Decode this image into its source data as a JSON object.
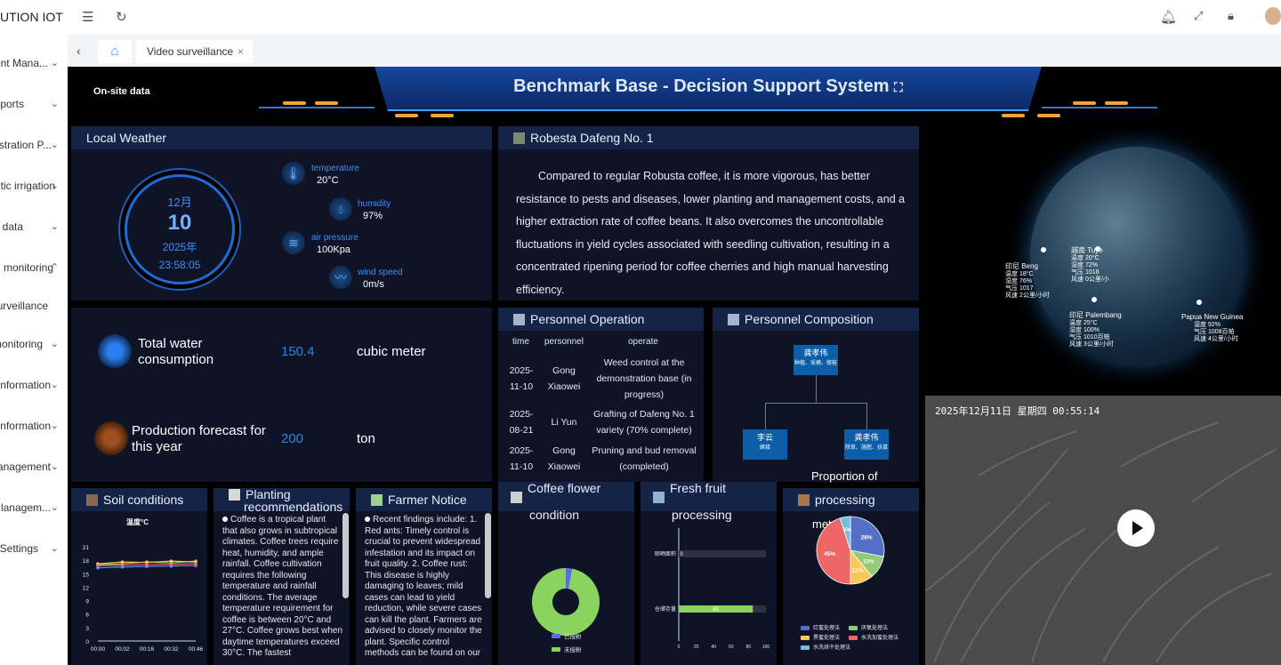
{
  "sidebar": {
    "brand": "UTION IOT",
    "items": [
      {
        "label": "ent Mana...",
        "chevron": "⌄"
      },
      {
        "label": "ports",
        "chevron": "⌄"
      },
      {
        "label": "stration P...",
        "chevron": "⌄"
      },
      {
        "label": "tic irrigation",
        "chevron": "⌄"
      },
      {
        "label": "data",
        "chevron": "⌄"
      },
      {
        "label": "monitoring",
        "chevron": "⌃"
      },
      {
        "label": "urveillance",
        "chevron": ""
      },
      {
        "label": "nonitoring",
        "chevron": "⌄"
      },
      {
        "label": "nformation",
        "chevron": "⌄"
      },
      {
        "label": "nformation",
        "chevron": "⌄"
      },
      {
        "label": "anagement",
        "chevron": "⌄"
      },
      {
        "label": "lanagem...",
        "chevron": "⌄"
      },
      {
        "label": "Settings",
        "chevron": "⌄"
      }
    ]
  },
  "tabs": {
    "active_label": "Video surveillance",
    "close": "×"
  },
  "dashboard": {
    "onsite_label": "On-site data",
    "title": "Benchmark Base - Decision Support System",
    "title_icon": "⛶",
    "weather": {
      "title": "Local Weather",
      "month": "12月",
      "day": "10",
      "year": "2025年",
      "time": "23:58:05",
      "temperature_label": "temperature",
      "temperature": "20°C",
      "humidity_label": "humidity",
      "humidity": "97%",
      "pressure_label": "air pressure",
      "pressure": "100Kpa",
      "wind_label": "wind speed",
      "wind": "0m/s"
    },
    "water": {
      "label_1": "Total water",
      "label_2": "consumption",
      "value": "150.4",
      "unit": "cubic meter"
    },
    "forecast": {
      "label_1": "Production forecast for",
      "label_2": "this year",
      "value": "200",
      "unit": "ton"
    },
    "variety": {
      "title": "Robesta Dafeng No. 1",
      "description": "Compared to regular Robusta coffee, it is more vigorous, has better resistance to pests and diseases, lower planting and management costs, and a higher extraction rate of coffee beans. It also overcomes the uncontrollable fluctuations in yield cycles associated with seedling cultivation, resulting in a concentrated ripening period for coffee cherries and high manual harvesting efficiency."
    },
    "personnel_op": {
      "title": "Personnel Operation",
      "headers": [
        "time",
        "personnel",
        "operate"
      ],
      "rows": [
        {
          "date_1": "2025-",
          "date_2": "11-10",
          "person_1": "Gong",
          "person_2": "Xiaowei",
          "op_1": "Weed control at the",
          "op_2": "demonstration base (in",
          "op_3": "progress)"
        },
        {
          "date_1": "2025-",
          "date_2": "08-21",
          "person_1": "Li Yun",
          "person_2": "",
          "op_1": "Grafting of Dafeng No. 1",
          "op_2": "variety (70% complete)",
          "op_3": ""
        },
        {
          "date_1": "2025-",
          "date_2": "11-10",
          "person_1": "Gong",
          "person_2": "Xiaowei",
          "op_1": "Pruning and bud removal",
          "op_2": "(completed)",
          "op_3": ""
        }
      ]
    },
    "personnel_comp": {
      "title": "Personnel Composition",
      "top": {
        "name": "龚孝伟",
        "role": "种植、采摘、修枝"
      },
      "left": {
        "name": "李云",
        "role": "嫁接"
      },
      "right": {
        "name": "龚孝伟",
        "role": "除草、施肥、扶苗"
      }
    },
    "proportion_label": "Proportion of",
    "soil": {
      "title": "Soil conditions",
      "chart_title": "温度°C"
    },
    "planting": {
      "title_1": "Planting",
      "title_2": "recommendations",
      "text": "Coffee is a tropical plant that also grows in subtropical climates. Coffee trees require heat, humidity, and ample rainfall. Coffee cultivation requires the following temperature and rainfall conditions. The average temperature requirement for coffee is between 20°C and 27°C. Coffee grows best when daytime temperatures exceed 30°C. The fastest"
    },
    "farmer": {
      "title": "Farmer Notice",
      "text": "Recent findings include: 1. Red ants: Timely control is crucial to prevent widespread infestation and its impact on fruit quality. 2. Coffee rust: This disease is highly damaging to leaves; mild cases can lead to yield reduction, while severe cases can kill the plant. Farmers are advised to closely monitor the plant. Specific control methods can be found on our"
    },
    "flower": {
      "title_1": "Coffee flower",
      "title_2": "condition"
    },
    "fruit": {
      "title_1": "Fresh fruit",
      "title_2": "processing"
    },
    "method": {
      "title": "processing",
      "title_2": "met"
    },
    "globe_labels": [
      {
        "name": "印尼 Beng",
        "lines": "温度 18°C\n湿度 76%\n气压 1017\n风速 2公里/小时"
      },
      {
        "name": "越南 Tuye",
        "lines": "温度 20°C\n湿度 72%\n气压 1018\n风速 0公里/小"
      },
      {
        "name": "印尼 Palembang",
        "lines": "温度 25°C\n湿度 100%\n气压 1010百帕\n风速 3公里/小时"
      },
      {
        "name": "Papua New Guinea",
        "lines": "湿度 92%\n气压 1008百帕\n风速 4公里/小时"
      }
    ],
    "camera": {
      "timestamp": "2025年12月11日 星期四 00:55:14"
    }
  },
  "chart_data": [
    {
      "type": "line",
      "title": "温度°C",
      "x": [
        "00:00",
        "00:02",
        "00:16",
        "00:32",
        "00:46"
      ],
      "ylim": [
        0,
        21
      ],
      "yticks": [
        0,
        3,
        6,
        9,
        12,
        15,
        18,
        21
      ],
      "series": [
        {
          "color": "#8bd35f",
          "values": [
            17,
            17.2,
            17.6,
            17.4,
            17.8
          ]
        },
        {
          "color": "#f6c85f",
          "values": [
            17.2,
            17.6,
            17.5,
            17.8,
            17.6
          ]
        },
        {
          "color": "#5b8ff9",
          "values": [
            16.3,
            16.5,
            16.6,
            16.7,
            16.8
          ]
        },
        {
          "color": "#f56c6c",
          "values": [
            16.8,
            16.9,
            17,
            17.1,
            17.2
          ]
        }
      ]
    },
    {
      "type": "pie",
      "legend": [
        "已授粉",
        "未授粉"
      ],
      "colors": [
        "#5b6ee1",
        "#8bd35f"
      ],
      "values": [
        3,
        97
      ]
    },
    {
      "type": "bar",
      "orientation": "horizontal",
      "categories": [
        "晾晒面积",
        "仓储存量"
      ],
      "values": [
        0,
        85
      ],
      "xlim": [
        0,
        100
      ],
      "xticks": [
        0,
        20,
        40,
        60,
        80,
        100
      ]
    },
    {
      "type": "pie",
      "categories": [
        "红蜜处理法",
        "厌氧处理法",
        "黑蜜处理法",
        "水洗加蜜处理法",
        "水洗烘干处理法"
      ],
      "colors": [
        "#5470c6",
        "#91cc75",
        "#fac858",
        "#ee6666",
        "#73c0de"
      ],
      "values": [
        28,
        11,
        11,
        45,
        5
      ]
    }
  ]
}
